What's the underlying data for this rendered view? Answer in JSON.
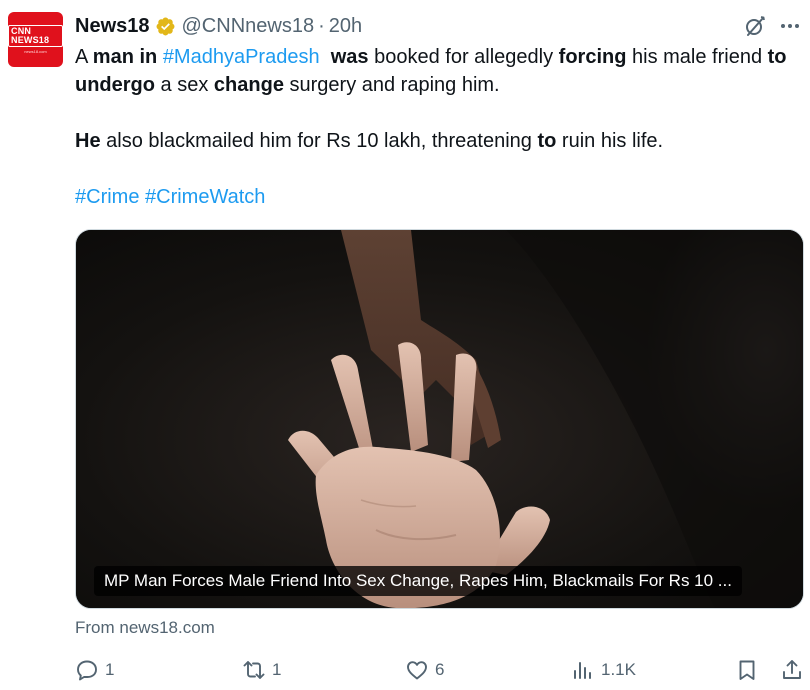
{
  "account": {
    "name": "News18",
    "handle": "@CNNnews18",
    "separator": "·",
    "time": "20h",
    "avatar_text": "CNN NEWS18",
    "avatar_subtext": "news18.com"
  },
  "tweet": {
    "line1": {
      "p1": "A ",
      "p2": "man in",
      "p3": " ",
      "p4": "#MadhyaPradesh",
      "p5": "  ",
      "p6": "was",
      "p7": " booked for allegedly ",
      "p8": "forcing",
      "p9": " his male friend ",
      "p10": "to undergo",
      "p11": " a sex ",
      "p12": "change",
      "p13": " surgery and raping him."
    },
    "line2": {
      "p1": "He",
      "p2": " also blackmailed him for Rs 10 lakh, threatening ",
      "p3": "to",
      "p4": " ruin his life."
    },
    "hashtags": {
      "h1": "#Crime",
      "h2": "#CrimeWatch"
    }
  },
  "card": {
    "caption": "MP Man Forces Male Friend Into Sex Change, Rapes Him, Blackmails For Rs 10 ...",
    "source": "From news18.com"
  },
  "actions": {
    "replies": "1",
    "reposts": "1",
    "likes": "6",
    "views": "1.1K"
  },
  "colors": {
    "link": "#1d9bf0",
    "muted": "#536471",
    "verified_gold": "#e2b719",
    "avatar_red": "#e0111c"
  },
  "icons": [
    "verified-badge-icon",
    "grok-icon",
    "more-icon",
    "reply-icon",
    "repost-icon",
    "like-icon",
    "views-icon",
    "bookmark-icon",
    "share-icon"
  ]
}
